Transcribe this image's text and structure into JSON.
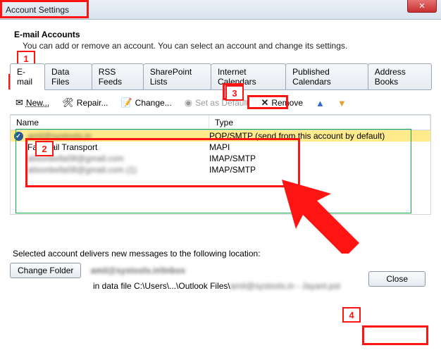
{
  "window": {
    "title": "Account Settings",
    "close_symbol": "✕"
  },
  "header": {
    "title": "E-mail Accounts",
    "subtitle": "You can add or remove an account. You can select an account and change its settings."
  },
  "tabs": [
    {
      "label": "E-mail",
      "active": true
    },
    {
      "label": "Data Files"
    },
    {
      "label": "RSS Feeds"
    },
    {
      "label": "SharePoint Lists"
    },
    {
      "label": "Internet Calendars"
    },
    {
      "label": "Published Calendars"
    },
    {
      "label": "Address Books"
    }
  ],
  "toolbar": {
    "new": "New...",
    "repair": "Repair...",
    "change": "Change...",
    "set_default": "Set as Default",
    "remove": "Remove"
  },
  "columns": {
    "name": "Name",
    "type": "Type"
  },
  "accounts": [
    {
      "name": "amit@systools.in",
      "type": "POP/SMTP (send from this account by default)",
      "default": true,
      "selected": true
    },
    {
      "name": "Fax Mail Transport",
      "type": "MAPI"
    },
    {
      "name": "alisonbella08@gmail.com",
      "type": "IMAP/SMTP"
    },
    {
      "name": "alisonbella08@gmail.com (1)",
      "type": "IMAP/SMTP"
    }
  ],
  "bottom": {
    "caption": "Selected account delivers new messages to the following location:",
    "change_folder": "Change Folder",
    "folder_path": "amit@systools.in\\Inbox",
    "data_file_prefix": "in data file C:\\Users\\...\\Outlook Files\\",
    "data_file_name": "amit@systools.in - Jayant.pst"
  },
  "buttons": {
    "close": "Close"
  },
  "annotations": {
    "n1": "1",
    "n2": "2",
    "n3": "3",
    "n4": "4"
  }
}
